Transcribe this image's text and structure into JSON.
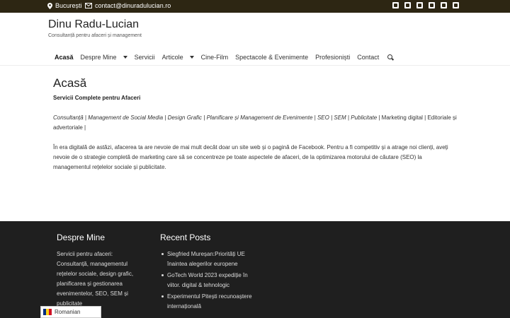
{
  "topbar": {
    "location": "București",
    "email": "contact@dinuradulucian.ro",
    "social_icons": [
      "linkedin-icon",
      "facebook-icon",
      "instagram-icon",
      "youtube-icon",
      "tiktok-icon",
      "twitter-icon"
    ]
  },
  "header": {
    "site_title": "Dinu Radu-Lucian",
    "tagline": "Consultanță pentru afaceri și management"
  },
  "nav": {
    "items": [
      {
        "label": "Acasă",
        "active": true
      },
      {
        "label": "Despre Mine",
        "dropdown": true
      },
      {
        "label": "Servicii"
      },
      {
        "label": "Articole",
        "dropdown": true
      },
      {
        "label": "Cine-Film"
      },
      {
        "label": "Spectacole & Evenimente"
      },
      {
        "label": "Profesioniști"
      },
      {
        "label": "Contact"
      }
    ]
  },
  "main": {
    "page_title": "Acasă",
    "subtitle": "Servicii Complete pentru Afaceri",
    "services_italic": "Consultanță | Management de Social Media | Design Grafic | Planificare și Management de Evenimente | SEO | SEM | Publicitate",
    "services_rest": "| Marketing digital | Editoriale și advertoriale |",
    "intro": "În era digitală de astăzi, afacerea ta are nevoie de mai mult decât doar un site web și o pagină de Facebook. Pentru a fi competitiv și a atrage noi clienți, aveți nevoie de o strategie completă de marketing care să se concentreze pe toate aspectele de afaceri, de la optimizarea motorului de căutare (SEO) la managementul rețelelor sociale și publicitate."
  },
  "footer": {
    "about_title": "Despre Mine",
    "about_text": "Servicii pentru afaceri: Consultanță, managementul rețelelor sociale, design grafic, planificarea și gestionarea evenimentelor, SEO, SEM și publicitate",
    "posts_title": "Recent Posts",
    "posts": [
      "Siegfried Mureșan:Priorități UE înaintea alegerilor europene",
      "GoTech World 2023 expediție în viitor. digital & tehnologic",
      "Experimentul Pitești recunoaștere internațională"
    ]
  },
  "language": {
    "label": "Romanian",
    "flag_colors": [
      "#002b7f",
      "#fcd116",
      "#ce1126"
    ]
  }
}
